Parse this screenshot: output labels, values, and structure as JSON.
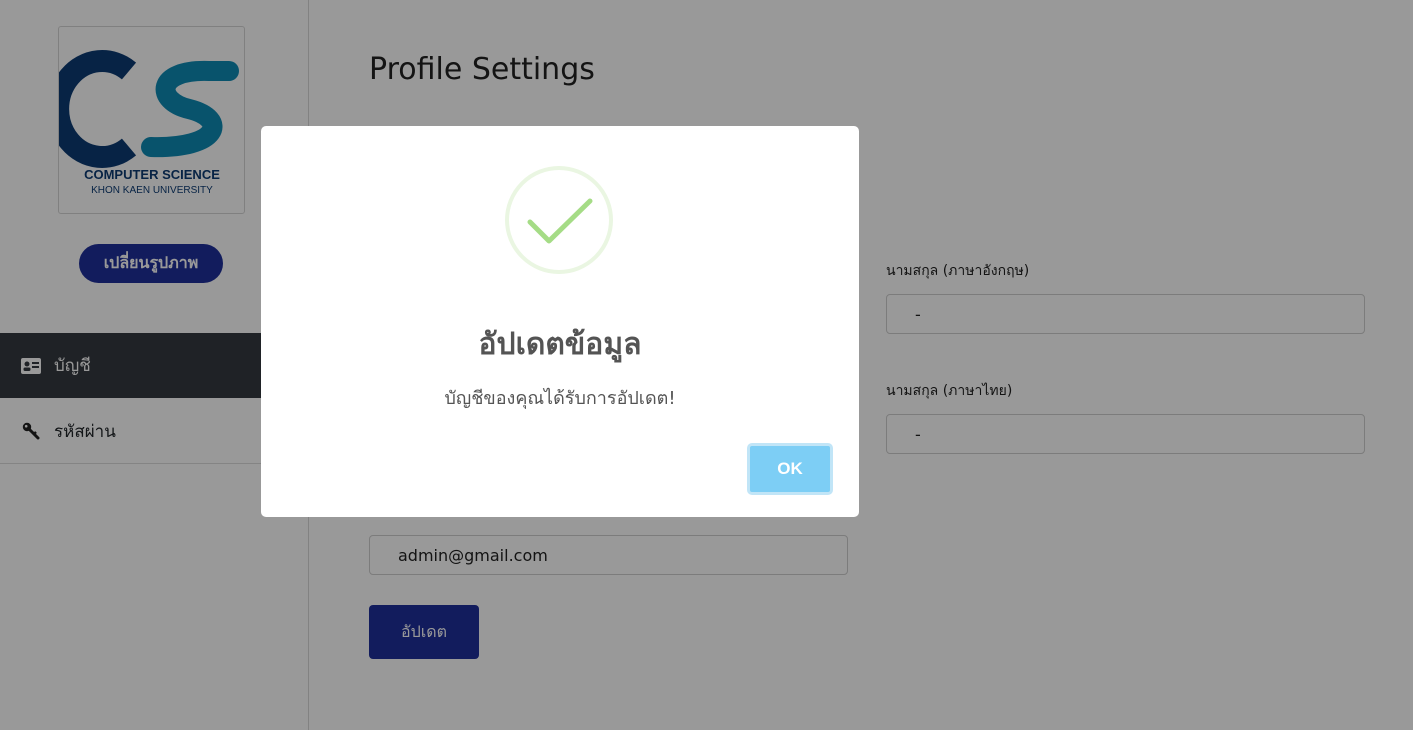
{
  "sidebar": {
    "logo": {
      "mark": "CS",
      "line1": "COMPUTER SCIENCE",
      "line2": "KHON KAEN UNIVERSITY"
    },
    "change_photo_label": "เปลี่ยนรูปภาพ",
    "items": [
      {
        "label": "บัญชี",
        "icon": "id-card-icon",
        "active": true
      },
      {
        "label": "รหัสผ่าน",
        "icon": "key-icon",
        "active": false
      }
    ]
  },
  "main": {
    "title": "Profile Settings",
    "fields": {
      "lastname_en": {
        "label": "นามสกุล (ภาษาอังกฤษ)",
        "value": "-"
      },
      "lastname_th": {
        "label": "นามสกุล (ภาษาไทย)",
        "value": "-"
      },
      "email": {
        "value": "admin@gmail.com"
      }
    },
    "update_label": "อัปเดต"
  },
  "modal": {
    "icon": "success-check-icon",
    "title": "อัปเดตข้อมูล",
    "text": "บัญชีของคุณได้รับการอัปเดต!",
    "ok_label": "OK"
  },
  "colors": {
    "primary": "#1e2f9b",
    "sidebar_active": "#343a40",
    "ok_button": "#7dcef5",
    "check": "#a5dc86",
    "logo_dark": "#0d3b73",
    "logo_light": "#0e8ab5"
  }
}
